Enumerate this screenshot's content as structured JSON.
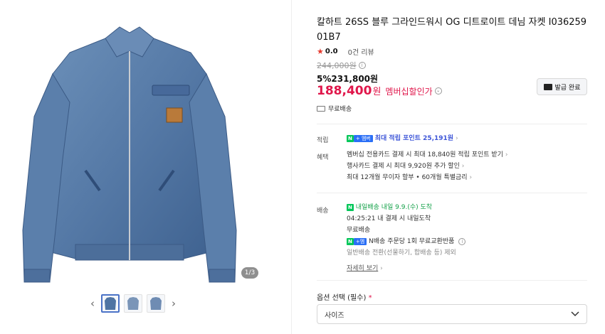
{
  "product": {
    "title": "칼하트 26SS 블루 그라인드워시 OG 디트로이트 데님 자켓 I036259 01B7",
    "rating_value": "0.0",
    "review_count": "0건 리뷰",
    "original_price": "244,000원",
    "discount_line": "5%231,800원",
    "member_price": "188,400",
    "member_won": "원",
    "member_label": "멤버십할인가",
    "coupon_button": "발급 완료",
    "free_shipping": "무료배송"
  },
  "gallery": {
    "counter": "1/3",
    "thumb_count": 3
  },
  "benefits": {
    "points_label": "적립",
    "npay_badge": "N",
    "nplus_badge": "+ 멤버",
    "points_text": "최대 적립 포인트 25,191원",
    "perks_label": "혜택",
    "perks": [
      "멤버십 전용카드 결제 시 최대 18,840원 적립 포인트 받기",
      "행사카드 결제 시 최대 9,920원 추가 할인",
      "최대 12개월 무이자 할부 • 60개월 특별금리"
    ]
  },
  "delivery": {
    "label": "배송",
    "tomorrow_badge": "내일배송",
    "arrival": "내일 9.9.(수) 도착",
    "timer": "04:25:21",
    "timer_note": "내 결제 시 내일도착",
    "free_shipping": "무료배송",
    "nplus_text": "N배송 주문당 1회 무료교환반품",
    "exclusion": "일반배송 전환(선물하기, 합배송 등) 제외",
    "details_link": "자세히 보기"
  },
  "options": {
    "label": "옵션 선택 (필수)",
    "required_mark": "*",
    "size_placeholder": "사이즈"
  },
  "colors": {
    "member_price": "#e0174b",
    "points": "#3e56d8",
    "npay_green": "#03c75a",
    "nplus_blue": "#2b6ff6"
  }
}
